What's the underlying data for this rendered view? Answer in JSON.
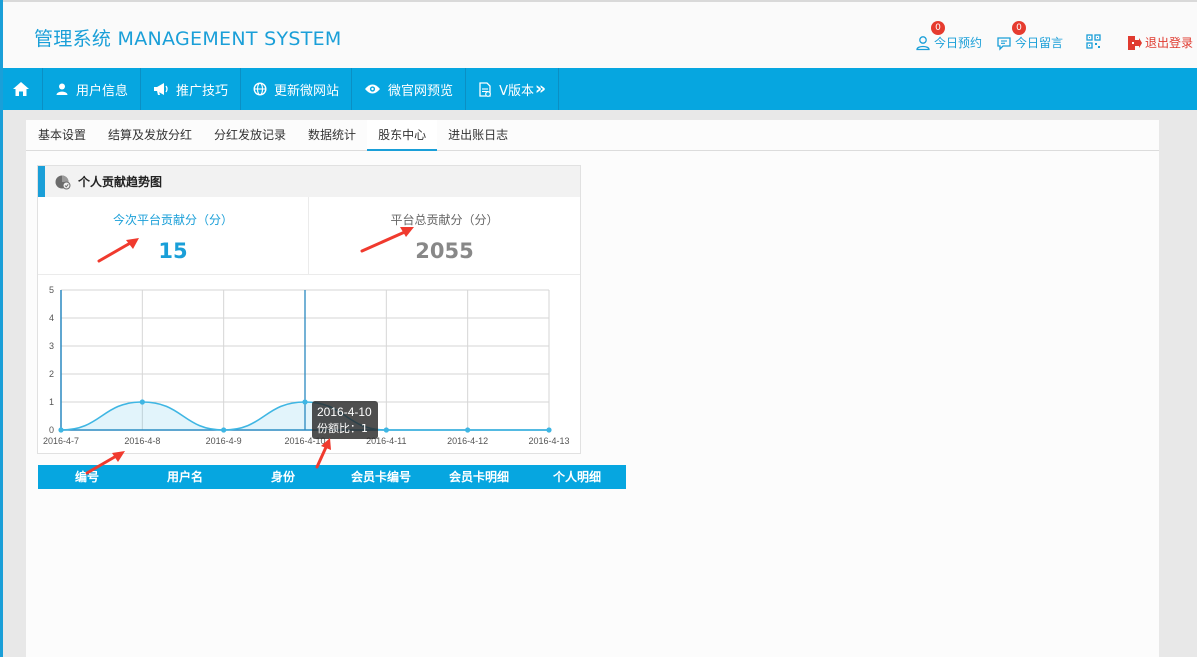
{
  "header": {
    "brand": "管理系统 MANAGEMENT SYSTEM",
    "appointments_label": "今日预约",
    "appointments_count": "0",
    "messages_label": "今日留言",
    "messages_count": "0",
    "qr_icon": "qrcode-icon",
    "logout_label": "退出登录"
  },
  "nav": {
    "items": [
      {
        "label": "",
        "icon": "home-icon"
      },
      {
        "label": "用户信息",
        "icon": "user-icon"
      },
      {
        "label": "推广技巧",
        "icon": "megaphone-icon"
      },
      {
        "label": "更新微网站",
        "icon": "globe-icon"
      },
      {
        "label": "微官网预览",
        "icon": "eye-icon"
      },
      {
        "label": "V版本",
        "icon": "document-icon"
      }
    ],
    "more_glyph": "»"
  },
  "tabs": [
    {
      "label": "基本设置",
      "active": false
    },
    {
      "label": "结算及发放分红",
      "active": false
    },
    {
      "label": "分红发放记录",
      "active": false
    },
    {
      "label": "数据统计",
      "active": false
    },
    {
      "label": "股东中心",
      "active": true
    },
    {
      "label": "进出账日志",
      "active": false
    }
  ],
  "panel": {
    "title": "个人贡献趋势图",
    "stat1_label": "今次平台贡献分（分）",
    "stat1_value": "15",
    "stat2_label": "平台总贡献分（分）",
    "stat2_value": "2055"
  },
  "chart_data": {
    "type": "area",
    "x": [
      "2016-4-7",
      "2016-4-8",
      "2016-4-9",
      "2016-4-10",
      "2016-4-11",
      "2016-4-12",
      "2016-4-13"
    ],
    "values": [
      0,
      1,
      0,
      1,
      0,
      0,
      0
    ],
    "ylim": [
      0,
      5
    ],
    "yticks": [
      0,
      1,
      2,
      3,
      4,
      5
    ],
    "grid": true,
    "color": "#3fb6e3",
    "tooltip": {
      "x_label": "2016-4-10",
      "series_label": "份额比",
      "separator": "：",
      "value": "1"
    }
  },
  "table": {
    "headers": [
      "编号",
      "用户名",
      "身份",
      "会员卡编号",
      "会员卡明细",
      "个人明细"
    ]
  },
  "colors": {
    "accent": "#06a6e0",
    "brand": "#1a9fd8",
    "danger": "#e03a2f"
  }
}
